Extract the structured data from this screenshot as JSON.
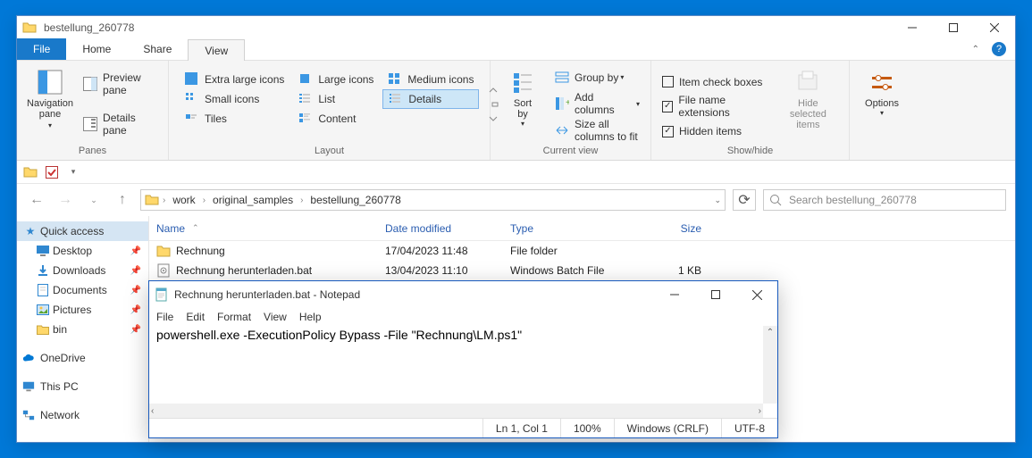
{
  "explorer": {
    "title": "bestellung_260778",
    "tabs": {
      "file": "File",
      "home": "Home",
      "share": "Share",
      "view": "View"
    },
    "panes": {
      "nav": "Navigation\npane",
      "preview": "Preview pane",
      "details": "Details pane",
      "group_label": "Panes"
    },
    "layout": {
      "xl": "Extra large icons",
      "lg": "Large icons",
      "md": "Medium icons",
      "sm": "Small icons",
      "list": "List",
      "det": "Details",
      "tiles": "Tiles",
      "content": "Content",
      "group_label": "Layout"
    },
    "current_view": {
      "sort": "Sort\nby",
      "group": "Group by",
      "addcols": "Add columns",
      "sizeall": "Size all columns to fit",
      "group_label": "Current view"
    },
    "showhide": {
      "itemchk": "Item check boxes",
      "ext": "File name extensions",
      "hidden": "Hidden items",
      "checked": {
        "itemchk": false,
        "ext": true,
        "hidden": true
      },
      "hidesel": "Hide selected\nitems",
      "group_label": "Show/hide"
    },
    "options": "Options",
    "breadcrumb": [
      "work",
      "original_samples",
      "bestellung_260778"
    ],
    "search_placeholder": "Search bestellung_260778",
    "columns": {
      "name": "Name",
      "date": "Date modified",
      "type": "Type",
      "size": "Size"
    },
    "rows": [
      {
        "icon": "folder",
        "name": "Rechnung",
        "date": "17/04/2023 11:48",
        "type": "File folder",
        "size": ""
      },
      {
        "icon": "bat",
        "name": "Rechnung herunterladen.bat",
        "date": "13/04/2023 11:10",
        "type": "Windows Batch File",
        "size": "1 KB"
      }
    ],
    "sidebar": {
      "quick": "Quick access",
      "items": [
        {
          "label": "Desktop",
          "pin": true,
          "ic": "desktop"
        },
        {
          "label": "Downloads",
          "pin": true,
          "ic": "download"
        },
        {
          "label": "Documents",
          "pin": true,
          "ic": "document"
        },
        {
          "label": "Pictures",
          "pin": true,
          "ic": "pictures"
        },
        {
          "label": "bin",
          "pin": true,
          "ic": "folder"
        }
      ],
      "onedrive": "OneDrive",
      "thispc": "This PC",
      "network": "Network"
    }
  },
  "notepad": {
    "title": "Rechnung herunterladen.bat - Notepad",
    "menu": [
      "File",
      "Edit",
      "Format",
      "View",
      "Help"
    ],
    "content": "powershell.exe -ExecutionPolicy Bypass -File \"Rechnung\\LM.ps1\"",
    "status": {
      "pos": "Ln 1, Col 1",
      "zoom": "100%",
      "eol": "Windows (CRLF)",
      "enc": "UTF-8"
    }
  }
}
